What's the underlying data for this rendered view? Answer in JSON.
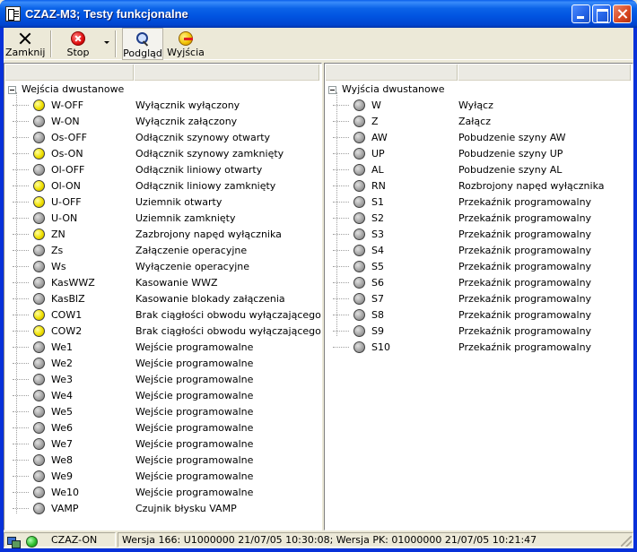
{
  "window": {
    "title": "CZAZ-M3; Testy funkcjonalne"
  },
  "toolbar": {
    "close_label": "Zamknij",
    "stop_label": "Stop",
    "preview_label": "Podgląd",
    "outputs_label": "Wyjścia"
  },
  "left": {
    "root_label": "Wejścia dwustanowe",
    "items": [
      {
        "code": "W-OFF",
        "desc": "Wyłącznik wyłączony",
        "led": "yellow"
      },
      {
        "code": "W-ON",
        "desc": "Wyłącznik załączony",
        "led": "gray"
      },
      {
        "code": "Os-OFF",
        "desc": "Odłącznik szynowy otwarty",
        "led": "gray"
      },
      {
        "code": "Os-ON",
        "desc": "Odłącznik szynowy zamknięty",
        "led": "yellow"
      },
      {
        "code": "Ol-OFF",
        "desc": "Odłącznik liniowy otwarty",
        "led": "gray"
      },
      {
        "code": "Ol-ON",
        "desc": "Odłącznik liniowy zamknięty",
        "led": "yellow"
      },
      {
        "code": "U-OFF",
        "desc": "Uziemnik otwarty",
        "led": "yellow"
      },
      {
        "code": "U-ON",
        "desc": "Uziemnik zamknięty",
        "led": "gray"
      },
      {
        "code": "ZN",
        "desc": "Zazbrojony napęd wyłącznika",
        "led": "yellow"
      },
      {
        "code": "Zs",
        "desc": "Załączenie operacyjne",
        "led": "gray"
      },
      {
        "code": "Ws",
        "desc": "Wyłączenie operacyjne",
        "led": "gray"
      },
      {
        "code": "KasWWZ",
        "desc": "Kasowanie WWZ",
        "led": "gray"
      },
      {
        "code": "KasBlZ",
        "desc": "Kasowanie blokady załączenia",
        "led": "gray"
      },
      {
        "code": "COW1",
        "desc": "Brak ciągłości obwodu wyłączającego",
        "led": "yellow"
      },
      {
        "code": "COW2",
        "desc": "Brak ciągłości obwodu wyłączającego",
        "led": "yellow"
      },
      {
        "code": "We1",
        "desc": "Wejście programowalne",
        "led": "gray"
      },
      {
        "code": "We2",
        "desc": "Wejście programowalne",
        "led": "gray"
      },
      {
        "code": "We3",
        "desc": "Wejście programowalne",
        "led": "gray"
      },
      {
        "code": "We4",
        "desc": "Wejście programowalne",
        "led": "gray"
      },
      {
        "code": "We5",
        "desc": "Wejście programowalne",
        "led": "gray"
      },
      {
        "code": "We6",
        "desc": "Wejście programowalne",
        "led": "gray"
      },
      {
        "code": "We7",
        "desc": "Wejście programowalne",
        "led": "gray"
      },
      {
        "code": "We8",
        "desc": "Wejście programowalne",
        "led": "gray"
      },
      {
        "code": "We9",
        "desc": "Wejście programowalne",
        "led": "gray"
      },
      {
        "code": "We10",
        "desc": "Wejście programowalne",
        "led": "gray"
      },
      {
        "code": "VAMP",
        "desc": "Czujnik błysku VAMP",
        "led": "gray"
      }
    ]
  },
  "right": {
    "root_label": "Wyjścia dwustanowe",
    "items": [
      {
        "code": "W",
        "desc": "Wyłącz",
        "led": "gray"
      },
      {
        "code": "Z",
        "desc": "Załącz",
        "led": "gray"
      },
      {
        "code": "AW",
        "desc": "Pobudzenie szyny AW",
        "led": "gray"
      },
      {
        "code": "UP",
        "desc": "Pobudzenie szyny UP",
        "led": "gray"
      },
      {
        "code": "AL",
        "desc": "Pobudzenie szyny AL",
        "led": "gray"
      },
      {
        "code": "RN",
        "desc": "Rozbrojony napęd wyłącznika",
        "led": "gray"
      },
      {
        "code": "S1",
        "desc": "Przekaźnik programowalny",
        "led": "gray"
      },
      {
        "code": "S2",
        "desc": "Przekaźnik programowalny",
        "led": "gray"
      },
      {
        "code": "S3",
        "desc": "Przekaźnik programowalny",
        "led": "gray"
      },
      {
        "code": "S4",
        "desc": "Przekaźnik programowalny",
        "led": "gray"
      },
      {
        "code": "S5",
        "desc": "Przekaźnik programowalny",
        "led": "gray"
      },
      {
        "code": "S6",
        "desc": "Przekaźnik programowalny",
        "led": "gray"
      },
      {
        "code": "S7",
        "desc": "Przekaźnik programowalny",
        "led": "gray"
      },
      {
        "code": "S8",
        "desc": "Przekaźnik programowalny",
        "led": "gray"
      },
      {
        "code": "S9",
        "desc": "Przekaźnik programowalny",
        "led": "gray"
      },
      {
        "code": "S10",
        "desc": "Przekaźnik programowalny",
        "led": "gray"
      }
    ]
  },
  "status": {
    "connection": "CZAZ-ON",
    "version": "Wersja 166: U1000000 21/07/05 10:30:08; Wersja PK: 01000000 21/07/05 10:21:47"
  },
  "colors": {
    "led_on": "#F0E000",
    "led_off": "#A0A0A0",
    "status_ok": "#30C030",
    "titlebar": "#0153E0"
  },
  "icons": {
    "close": "close-x-icon",
    "stop": "stop-icon",
    "preview": "magnifier-icon",
    "outputs": "outputs-icon",
    "app": "app-icon",
    "network": "network-icon"
  }
}
